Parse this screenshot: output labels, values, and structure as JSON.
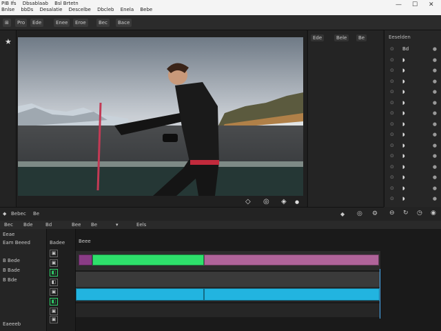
{
  "titlebar": {
    "menu_row1": [
      "PIB Ifs",
      "Dbsablaab",
      "Bsl Brtetn"
    ],
    "menu_row2": [
      "Bnlse",
      "bbDs",
      "Desalatie",
      "Descelbe",
      "Dbcleb",
      "Enela",
      "Bebe"
    ],
    "min": "—",
    "max": "☐",
    "close": "✕"
  },
  "toolbar": {
    "buttons": [
      "Pro",
      "Ede",
      "Enee",
      "Eroe",
      "Bec",
      "Bace"
    ]
  },
  "viewer": {
    "controls": [
      "◇",
      "◎",
      "◈",
      "●"
    ]
  },
  "midpanel": {
    "tabs": [
      "Ede",
      "Bele",
      "Be"
    ]
  },
  "rightpanel": {
    "title": "Eeselden",
    "rows": [
      {
        "label": "Bd",
        "val": "●"
      },
      {
        "label": "◗",
        "val": "●"
      },
      {
        "label": "◗",
        "val": "●"
      },
      {
        "label": "◗",
        "val": "●"
      },
      {
        "label": "◗",
        "val": "●"
      },
      {
        "label": "◗",
        "val": "●"
      },
      {
        "label": "◗",
        "val": "●"
      },
      {
        "label": "◗",
        "val": "●"
      },
      {
        "label": "◗",
        "val": "●"
      },
      {
        "label": "◗",
        "val": "●"
      },
      {
        "label": "◗",
        "val": "●"
      },
      {
        "label": "◗",
        "val": "●"
      },
      {
        "label": "◗",
        "val": "●"
      },
      {
        "label": "◗",
        "val": "●"
      },
      {
        "label": "◗",
        "val": "●"
      }
    ]
  },
  "section": {
    "label": "Bebec",
    "tab": "Be"
  },
  "tlheader": {
    "items": [
      "Bec",
      "Bde",
      "Bd",
      "Bee",
      "Be"
    ],
    "left_label": "Eels",
    "sub_labels": [
      "Eeae",
      "Badee"
    ]
  },
  "trackctrl": {
    "title": "Eam Beeed",
    "tracks": [
      "B Bede",
      "B Bade",
      "B Bde"
    ],
    "footer": "Eaeeeb"
  },
  "timeline": {
    "ruler_label": "Beee"
  }
}
